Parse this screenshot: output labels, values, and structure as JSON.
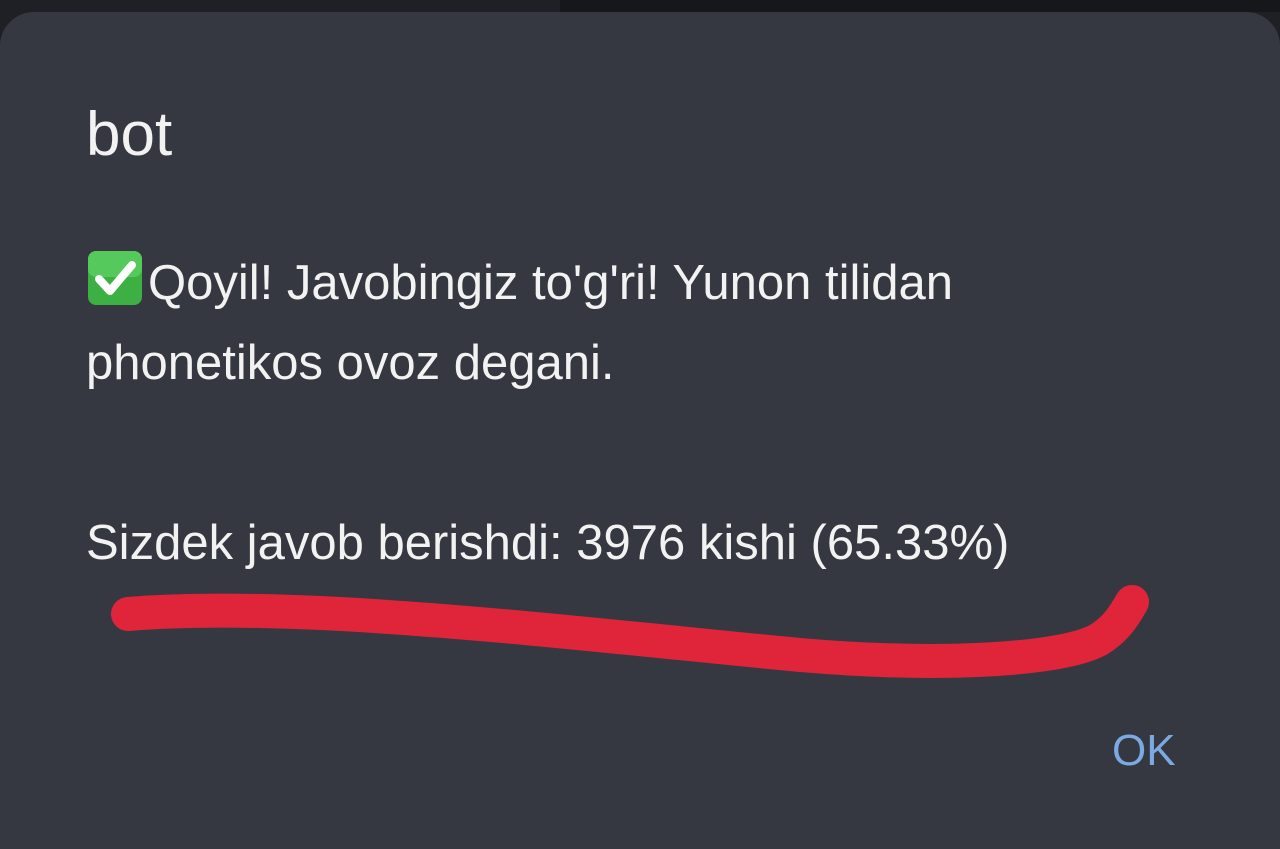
{
  "dialog": {
    "title": "bot",
    "message_icon": "check-mark-button-icon",
    "message_line1": "Qoyil! Javobingiz to'g'ri! Yunon tilidan",
    "message_line2": "phonetikos ovoz degani.",
    "stats_text": "Sizdek javob berishdi: 3976 kishi (65.33%)",
    "ok_label": "OK"
  },
  "colors": {
    "dialog_background": "#353840",
    "text": "#f2f2f2",
    "accent": "#7ba9e1",
    "annotation_underline": "#e0253a",
    "check_icon_green": "#3cb043"
  }
}
